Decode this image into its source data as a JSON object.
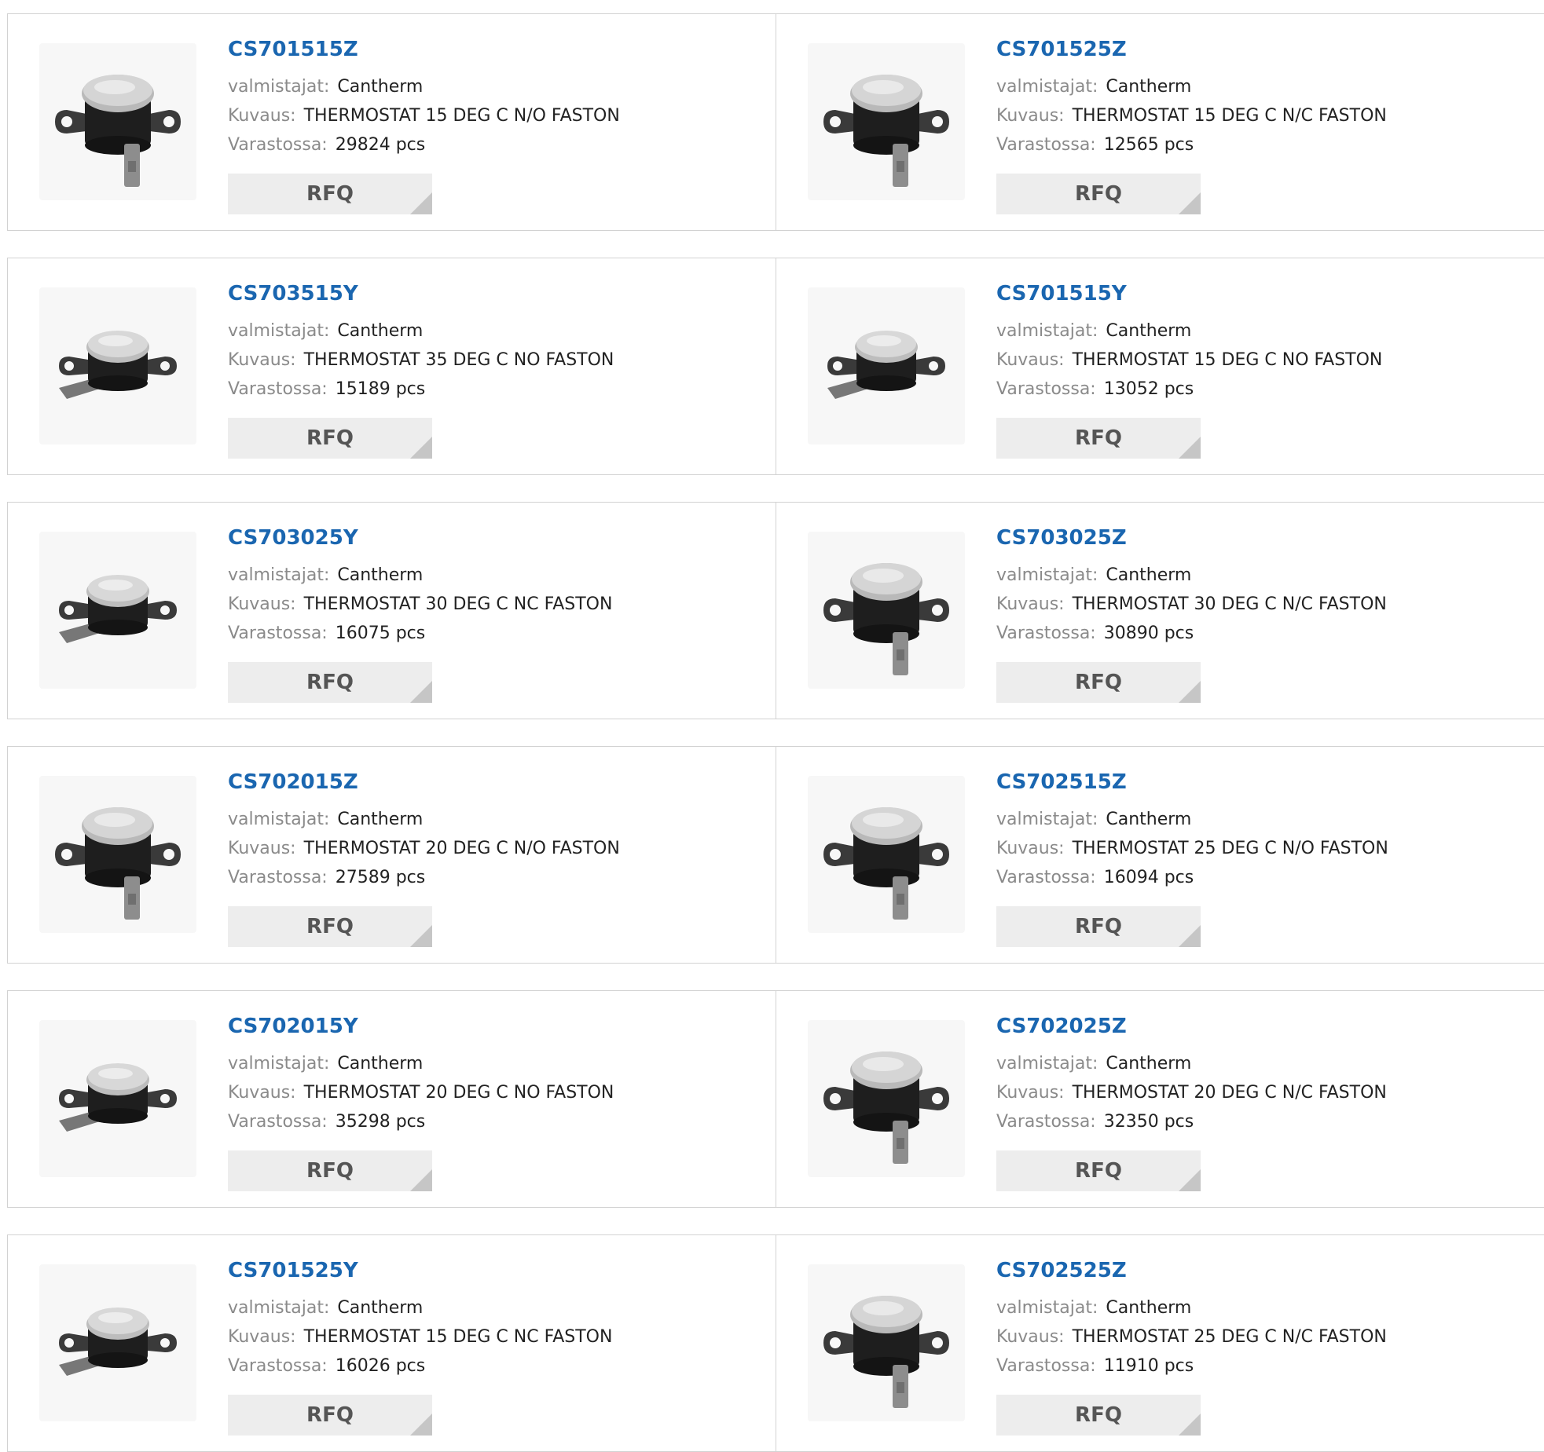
{
  "labels": {
    "manufacturer": "valmistajat:",
    "description": "Kuvaus:",
    "stock": "Varastossa:",
    "rfq": "RFQ"
  },
  "colors": {
    "part_link": "#1a66b0",
    "label_text": "#8a8a8a",
    "value_text": "#222222",
    "rfq_bg": "#ededed",
    "border": "#d2d2d2"
  },
  "products": [
    {
      "part": "CS701515Z",
      "manufacturer": "Cantherm",
      "description": "THERMOSTAT 15 DEG C N/O FASTON",
      "stock": "29824 pcs",
      "image": "thermostat-upright-icon"
    },
    {
      "part": "CS701525Z",
      "manufacturer": "Cantherm",
      "description": "THERMOSTAT 15 DEG C N/C FASTON",
      "stock": "12565 pcs",
      "image": "thermostat-upright-icon"
    },
    {
      "part": "CS703515Y",
      "manufacturer": "Cantherm",
      "description": "THERMOSTAT 35 DEG C NO FASTON",
      "stock": "15189 pcs",
      "image": "thermostat-side-icon"
    },
    {
      "part": "CS701515Y",
      "manufacturer": "Cantherm",
      "description": "THERMOSTAT 15 DEG C NO FASTON",
      "stock": "13052 pcs",
      "image": "thermostat-side-icon"
    },
    {
      "part": "CS703025Y",
      "manufacturer": "Cantherm",
      "description": "THERMOSTAT 30 DEG C NC FASTON",
      "stock": "16075 pcs",
      "image": "thermostat-side-icon"
    },
    {
      "part": "CS703025Z",
      "manufacturer": "Cantherm",
      "description": "THERMOSTAT 30 DEG C N/C FASTON",
      "stock": "30890 pcs",
      "image": "thermostat-upright-icon"
    },
    {
      "part": "CS702015Z",
      "manufacturer": "Cantherm",
      "description": "THERMOSTAT 20 DEG C N/O FASTON",
      "stock": "27589 pcs",
      "image": "thermostat-upright-icon"
    },
    {
      "part": "CS702515Z",
      "manufacturer": "Cantherm",
      "description": "THERMOSTAT 25 DEG C N/O FASTON",
      "stock": "16094 pcs",
      "image": "thermostat-upright-icon"
    },
    {
      "part": "CS702015Y",
      "manufacturer": "Cantherm",
      "description": "THERMOSTAT 20 DEG C NO FASTON",
      "stock": "35298 pcs",
      "image": "thermostat-side-icon"
    },
    {
      "part": "CS702025Z",
      "manufacturer": "Cantherm",
      "description": "THERMOSTAT 20 DEG C N/C FASTON",
      "stock": "32350 pcs",
      "image": "thermostat-upright-icon"
    },
    {
      "part": "CS701525Y",
      "manufacturer": "Cantherm",
      "description": "THERMOSTAT 15 DEG C NC FASTON",
      "stock": "16026 pcs",
      "image": "thermostat-side-icon"
    },
    {
      "part": "CS702525Z",
      "manufacturer": "Cantherm",
      "description": "THERMOSTAT 25 DEG C N/C FASTON",
      "stock": "11910 pcs",
      "image": "thermostat-upright-icon"
    }
  ]
}
